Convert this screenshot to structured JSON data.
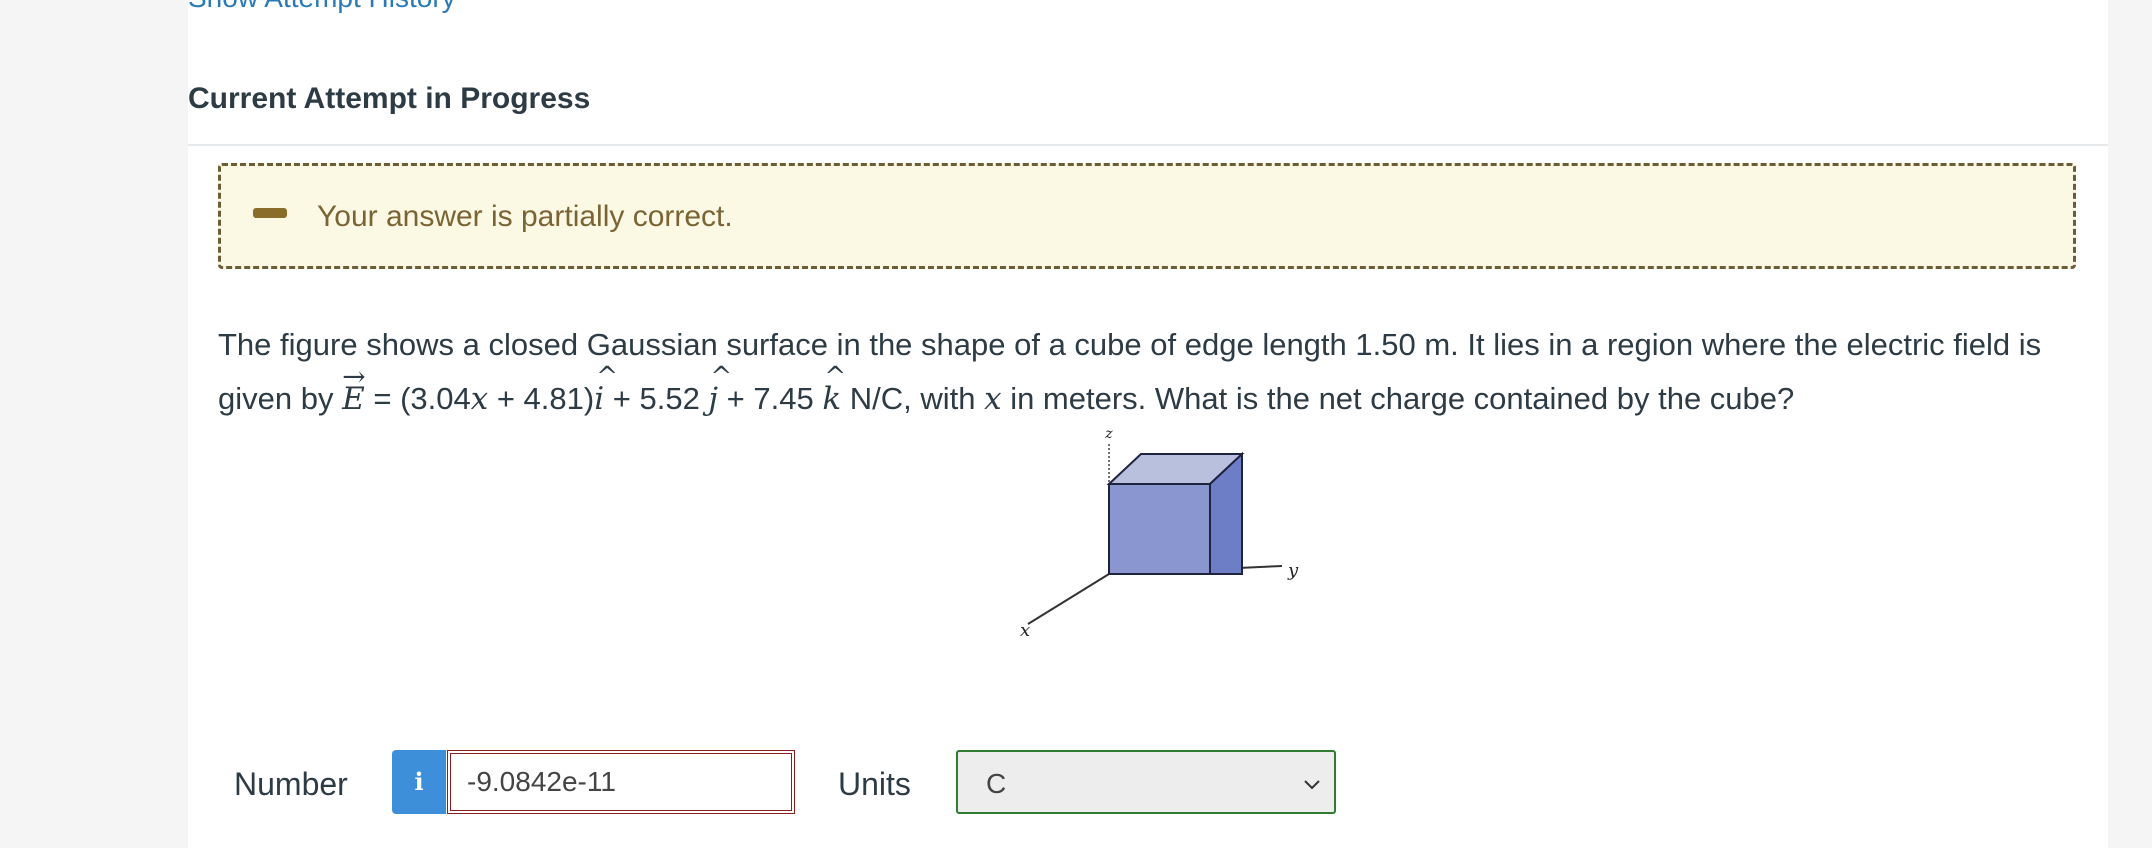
{
  "header": {
    "history_link": "Show Attempt History",
    "attempt_title": "Current Attempt in Progress"
  },
  "feedback": {
    "message": "Your answer is partially correct.",
    "icon": "minus-icon",
    "color": "#fbf8e4"
  },
  "question": {
    "part1": "The figure shows a closed Gaussian surface in the shape of a cube of edge length 1.50 m. It lies in a region where the electric field is",
    "part2": "given by",
    "E": "E",
    "eq1": " = (3.04",
    "x1": "x",
    "eq2": " + 4.81)",
    "ihat": "i",
    "eq3": " + 5.52 ",
    "jhat": "j",
    "eq4": " + 7.45 ",
    "khat": "k",
    "eq5": " N/C, with ",
    "x2": "x",
    "eq6": " in meters. What is the net charge contained by the cube?"
  },
  "figure": {
    "axis_z": "z",
    "axis_y": "y",
    "axis_x": "x"
  },
  "answer": {
    "number_label": "Number",
    "info_icon": "i",
    "number_value": "-9.0842e-11",
    "units_label": "Units",
    "units_value": "C"
  }
}
